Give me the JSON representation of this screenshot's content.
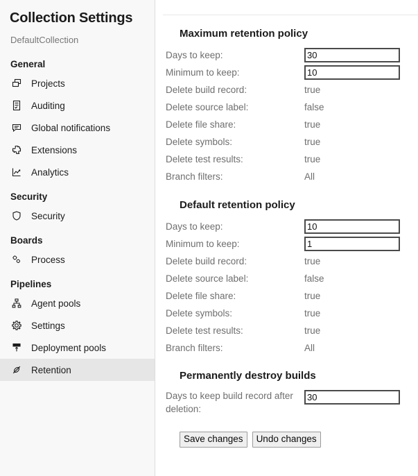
{
  "sidebar": {
    "title": "Collection Settings",
    "subtitle": "DefaultCollection",
    "groups": [
      {
        "title": "General",
        "items": [
          {
            "label": "Projects",
            "icon": "projects-icon"
          },
          {
            "label": "Auditing",
            "icon": "auditing-icon"
          },
          {
            "label": "Global notifications",
            "icon": "notifications-icon"
          },
          {
            "label": "Extensions",
            "icon": "extensions-icon"
          },
          {
            "label": "Analytics",
            "icon": "analytics-icon"
          }
        ]
      },
      {
        "title": "Security",
        "items": [
          {
            "label": "Security",
            "icon": "shield-icon"
          }
        ]
      },
      {
        "title": "Boards",
        "items": [
          {
            "label": "Process",
            "icon": "process-icon"
          }
        ]
      },
      {
        "title": "Pipelines",
        "items": [
          {
            "label": "Agent pools",
            "icon": "agent-pools-icon"
          },
          {
            "label": "Settings",
            "icon": "gear-icon"
          },
          {
            "label": "Deployment pools",
            "icon": "deployment-pools-icon"
          },
          {
            "label": "Retention",
            "icon": "retention-icon"
          }
        ]
      }
    ],
    "selected_item": "Retention"
  },
  "main": {
    "sections": [
      {
        "heading": "Maximum retention policy",
        "rows": [
          {
            "label": "Days to keep:",
            "value": "30",
            "type": "input"
          },
          {
            "label": "Minimum to keep:",
            "value": "10",
            "type": "input"
          },
          {
            "label": "Delete build record:",
            "value": "true",
            "type": "text"
          },
          {
            "label": "Delete source label:",
            "value": "false",
            "type": "text"
          },
          {
            "label": "Delete file share:",
            "value": "true",
            "type": "text"
          },
          {
            "label": "Delete symbols:",
            "value": "true",
            "type": "text"
          },
          {
            "label": "Delete test results:",
            "value": "true",
            "type": "text"
          },
          {
            "label": "Branch filters:",
            "value": "All",
            "type": "text"
          }
        ]
      },
      {
        "heading": "Default retention policy",
        "rows": [
          {
            "label": "Days to keep:",
            "value": "10",
            "type": "input"
          },
          {
            "label": "Minimum to keep:",
            "value": "1",
            "type": "input"
          },
          {
            "label": "Delete build record:",
            "value": "true",
            "type": "text"
          },
          {
            "label": "Delete source label:",
            "value": "false",
            "type": "text"
          },
          {
            "label": "Delete file share:",
            "value": "true",
            "type": "text"
          },
          {
            "label": "Delete symbols:",
            "value": "true",
            "type": "text"
          },
          {
            "label": "Delete test results:",
            "value": "true",
            "type": "text"
          },
          {
            "label": "Branch filters:",
            "value": "All",
            "type": "text"
          }
        ]
      },
      {
        "heading": "Permanently destroy builds",
        "rows": [
          {
            "label": "Days to keep build record after deletion:",
            "value": "30",
            "type": "input-tall"
          }
        ]
      }
    ],
    "buttons": {
      "save_label": "Save changes",
      "undo_label": "Undo changes"
    }
  },
  "colors": {
    "sidebar_bg": "#f8f8f8",
    "selected_bg": "#e6e6e6",
    "label_text": "#6e6e6e",
    "heading_text": "#1b1b1b",
    "input_border": "#4a4a4a",
    "button_bg": "#efefef"
  }
}
